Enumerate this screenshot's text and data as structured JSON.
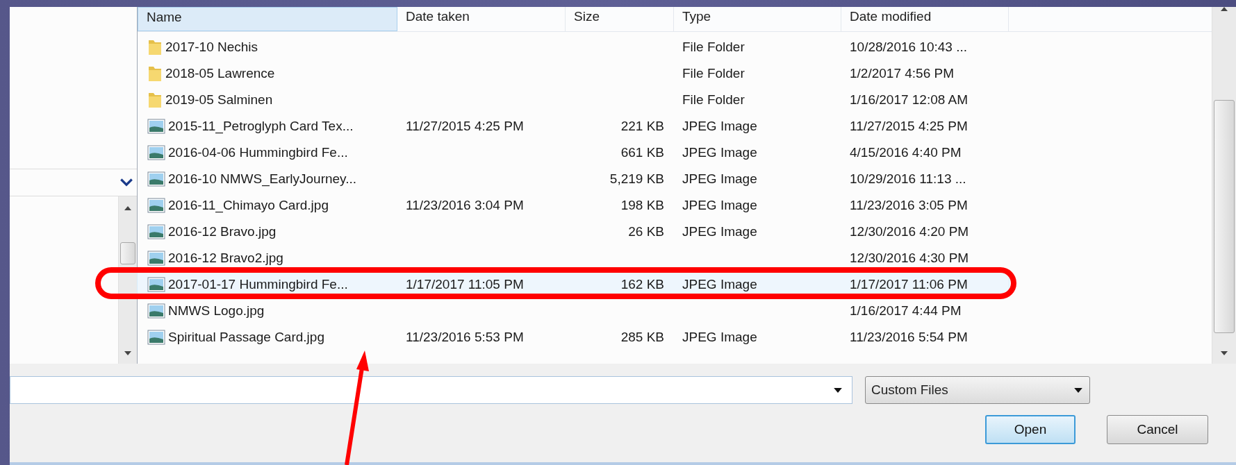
{
  "file_list": {
    "columns": [
      "Name",
      "Date taken",
      "Size",
      "Type",
      "Date modified"
    ],
    "rows": [
      {
        "kind": "folder",
        "name": "2017-10 Nechis",
        "date_taken": "",
        "size": "",
        "type": "File Folder",
        "date_modified": "10/28/2016 10:43 ...",
        "selected": false
      },
      {
        "kind": "folder",
        "name": "2018-05 Lawrence",
        "date_taken": "",
        "size": "",
        "type": "File Folder",
        "date_modified": "1/2/2017 4:56 PM",
        "selected": false
      },
      {
        "kind": "folder",
        "name": "2019-05 Salminen",
        "date_taken": "",
        "size": "",
        "type": "File Folder",
        "date_modified": "1/16/2017 12:08 AM",
        "selected": false
      },
      {
        "kind": "image",
        "name": "2015-11_Petroglyph Card Tex...",
        "date_taken": "11/27/2015 4:25 PM",
        "size": "221 KB",
        "type": "JPEG Image",
        "date_modified": "11/27/2015 4:25 PM",
        "selected": false
      },
      {
        "kind": "image",
        "name": "2016-04-06 Hummingbird Fe...",
        "date_taken": "",
        "size": "661 KB",
        "type": "JPEG Image",
        "date_modified": "4/15/2016 4:40 PM",
        "selected": false
      },
      {
        "kind": "image",
        "name": "2016-10 NMWS_EarlyJourney...",
        "date_taken": "",
        "size": "5,219 KB",
        "type": "JPEG Image",
        "date_modified": "10/29/2016 11:13 ...",
        "selected": false
      },
      {
        "kind": "image",
        "name": "2016-11_Chimayo Card.jpg",
        "date_taken": "11/23/2016 3:04 PM",
        "size": "198 KB",
        "type": "JPEG Image",
        "date_modified": "11/23/2016 3:05 PM",
        "selected": false
      },
      {
        "kind": "image",
        "name": "2016-12 Bravo.jpg",
        "date_taken": "",
        "size": "26 KB",
        "type": "JPEG Image",
        "date_modified": "12/30/2016 4:20 PM",
        "selected": false
      },
      {
        "kind": "image",
        "name": "2016-12 Bravo2.jpg",
        "date_taken": "",
        "size": "",
        "type": "",
        "date_modified": "12/30/2016 4:30 PM",
        "selected": false
      },
      {
        "kind": "image",
        "name": "2017-01-17 Hummingbird Fe...",
        "date_taken": "1/17/2017 11:05 PM",
        "size": "162 KB",
        "type": "JPEG Image",
        "date_modified": "1/17/2017 11:06 PM",
        "selected": true
      },
      {
        "kind": "image",
        "name": "NMWS Logo.jpg",
        "date_taken": "",
        "size": "",
        "type": "",
        "date_modified": "1/16/2017 4:44 PM",
        "selected": false
      },
      {
        "kind": "image",
        "name": "Spiritual Passage Card.jpg",
        "date_taken": "11/23/2016 5:53 PM",
        "size": "285 KB",
        "type": "JPEG Image",
        "date_modified": "11/23/2016 5:54 PM",
        "selected": false
      }
    ]
  },
  "file_type_filter": {
    "value": "Custom Files"
  },
  "buttons": [
    "Open",
    "Cancel"
  ]
}
